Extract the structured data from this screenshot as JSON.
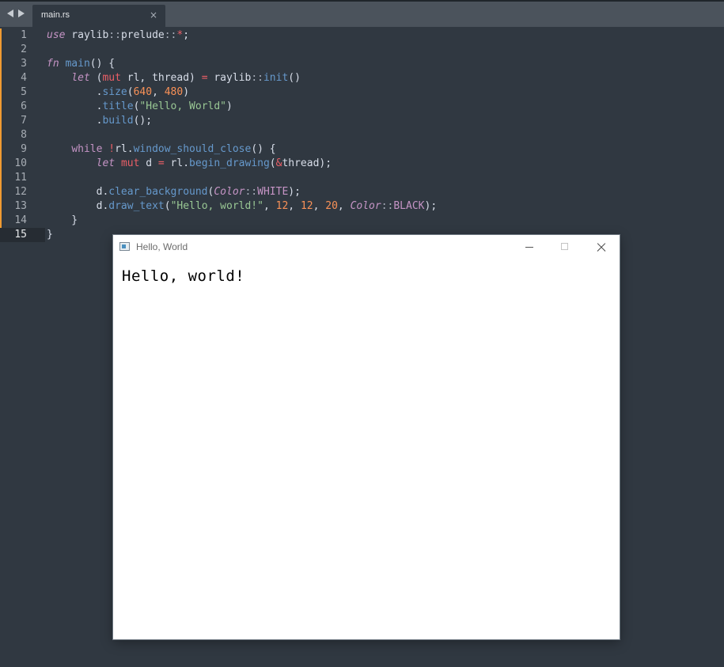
{
  "editor": {
    "tab": {
      "label": "main.rs",
      "close_glyph": "×"
    },
    "lines": [
      {
        "n": "1",
        "tokens": [
          {
            "t": "use",
            "c": "kw"
          },
          {
            "t": " raylib",
            "c": "plain"
          },
          {
            "t": "::",
            "c": "path"
          },
          {
            "t": "prelude",
            "c": "plain"
          },
          {
            "t": "::",
            "c": "path"
          },
          {
            "t": "*",
            "c": "op"
          },
          {
            "t": ";",
            "c": "plain"
          }
        ]
      },
      {
        "n": "2",
        "tokens": []
      },
      {
        "n": "3",
        "tokens": [
          {
            "t": "fn",
            "c": "kw"
          },
          {
            "t": " ",
            "c": "plain"
          },
          {
            "t": "main",
            "c": "fn"
          },
          {
            "t": "() {",
            "c": "plain"
          }
        ]
      },
      {
        "n": "4",
        "tokens": [
          {
            "t": "    ",
            "c": "plain"
          },
          {
            "t": "let",
            "c": "kw"
          },
          {
            "t": " (",
            "c": "plain"
          },
          {
            "t": "mut",
            "c": "op"
          },
          {
            "t": " rl, thread) ",
            "c": "plain"
          },
          {
            "t": "=",
            "c": "op"
          },
          {
            "t": " raylib",
            "c": "plain"
          },
          {
            "t": "::",
            "c": "path"
          },
          {
            "t": "init",
            "c": "fn"
          },
          {
            "t": "()",
            "c": "plain"
          }
        ]
      },
      {
        "n": "5",
        "tokens": [
          {
            "t": "        .",
            "c": "plain"
          },
          {
            "t": "size",
            "c": "fn"
          },
          {
            "t": "(",
            "c": "plain"
          },
          {
            "t": "640",
            "c": "num"
          },
          {
            "t": ", ",
            "c": "plain"
          },
          {
            "t": "480",
            "c": "num"
          },
          {
            "t": ")",
            "c": "plain"
          }
        ]
      },
      {
        "n": "6",
        "tokens": [
          {
            "t": "        .",
            "c": "plain"
          },
          {
            "t": "title",
            "c": "fn"
          },
          {
            "t": "(",
            "c": "plain"
          },
          {
            "t": "\"Hello, World\"",
            "c": "str"
          },
          {
            "t": ")",
            "c": "plain"
          }
        ]
      },
      {
        "n": "7",
        "tokens": [
          {
            "t": "        .",
            "c": "plain"
          },
          {
            "t": "build",
            "c": "fn"
          },
          {
            "t": "();",
            "c": "plain"
          }
        ]
      },
      {
        "n": "8",
        "tokens": []
      },
      {
        "n": "9",
        "tokens": [
          {
            "t": "    ",
            "c": "plain"
          },
          {
            "t": "while",
            "c": "kw2"
          },
          {
            "t": " ",
            "c": "plain"
          },
          {
            "t": "!",
            "c": "op"
          },
          {
            "t": "rl.",
            "c": "plain"
          },
          {
            "t": "window_should_close",
            "c": "fn"
          },
          {
            "t": "() {",
            "c": "plain"
          }
        ]
      },
      {
        "n": "10",
        "tokens": [
          {
            "t": "        ",
            "c": "plain"
          },
          {
            "t": "let",
            "c": "kw"
          },
          {
            "t": " ",
            "c": "plain"
          },
          {
            "t": "mut",
            "c": "op"
          },
          {
            "t": " d ",
            "c": "plain"
          },
          {
            "t": "=",
            "c": "op"
          },
          {
            "t": " rl.",
            "c": "plain"
          },
          {
            "t": "begin_drawing",
            "c": "fn"
          },
          {
            "t": "(",
            "c": "plain"
          },
          {
            "t": "&",
            "c": "op"
          },
          {
            "t": "thread);",
            "c": "plain"
          }
        ]
      },
      {
        "n": "11",
        "tokens": []
      },
      {
        "n": "12",
        "tokens": [
          {
            "t": "        d.",
            "c": "plain"
          },
          {
            "t": "clear_background",
            "c": "fn"
          },
          {
            "t": "(",
            "c": "plain"
          },
          {
            "t": "Color",
            "c": "ty"
          },
          {
            "t": "::",
            "c": "path"
          },
          {
            "t": "WHITE",
            "c": "ct"
          },
          {
            "t": ");",
            "c": "plain"
          }
        ]
      },
      {
        "n": "13",
        "tokens": [
          {
            "t": "        d.",
            "c": "plain"
          },
          {
            "t": "draw_text",
            "c": "fn"
          },
          {
            "t": "(",
            "c": "plain"
          },
          {
            "t": "\"Hello, world!\"",
            "c": "str"
          },
          {
            "t": ", ",
            "c": "plain"
          },
          {
            "t": "12",
            "c": "num"
          },
          {
            "t": ", ",
            "c": "plain"
          },
          {
            "t": "12",
            "c": "num"
          },
          {
            "t": ", ",
            "c": "plain"
          },
          {
            "t": "20",
            "c": "num"
          },
          {
            "t": ", ",
            "c": "plain"
          },
          {
            "t": "Color",
            "c": "ty"
          },
          {
            "t": "::",
            "c": "path"
          },
          {
            "t": "BLACK",
            "c": "ct"
          },
          {
            "t": ");",
            "c": "plain"
          }
        ]
      },
      {
        "n": "14",
        "tokens": [
          {
            "t": "    }",
            "c": "plain"
          }
        ]
      },
      {
        "n": "15",
        "tokens": [
          {
            "t": "}",
            "c": "plain"
          }
        ]
      }
    ],
    "modified_lines": [
      "1",
      "2",
      "3",
      "4",
      "5",
      "6",
      "7",
      "8",
      "9",
      "10",
      "11",
      "12",
      "13",
      "14",
      "15"
    ],
    "active_line": "15",
    "colors": {
      "background": "#303841",
      "tabbar": "#4b535c",
      "modified_marker": "#f09b32"
    }
  },
  "app_window": {
    "title": "Hello, World",
    "canvas_text": "Hello, world!",
    "controls": [
      "minimize",
      "maximize",
      "close"
    ],
    "background": "#ffffff"
  }
}
